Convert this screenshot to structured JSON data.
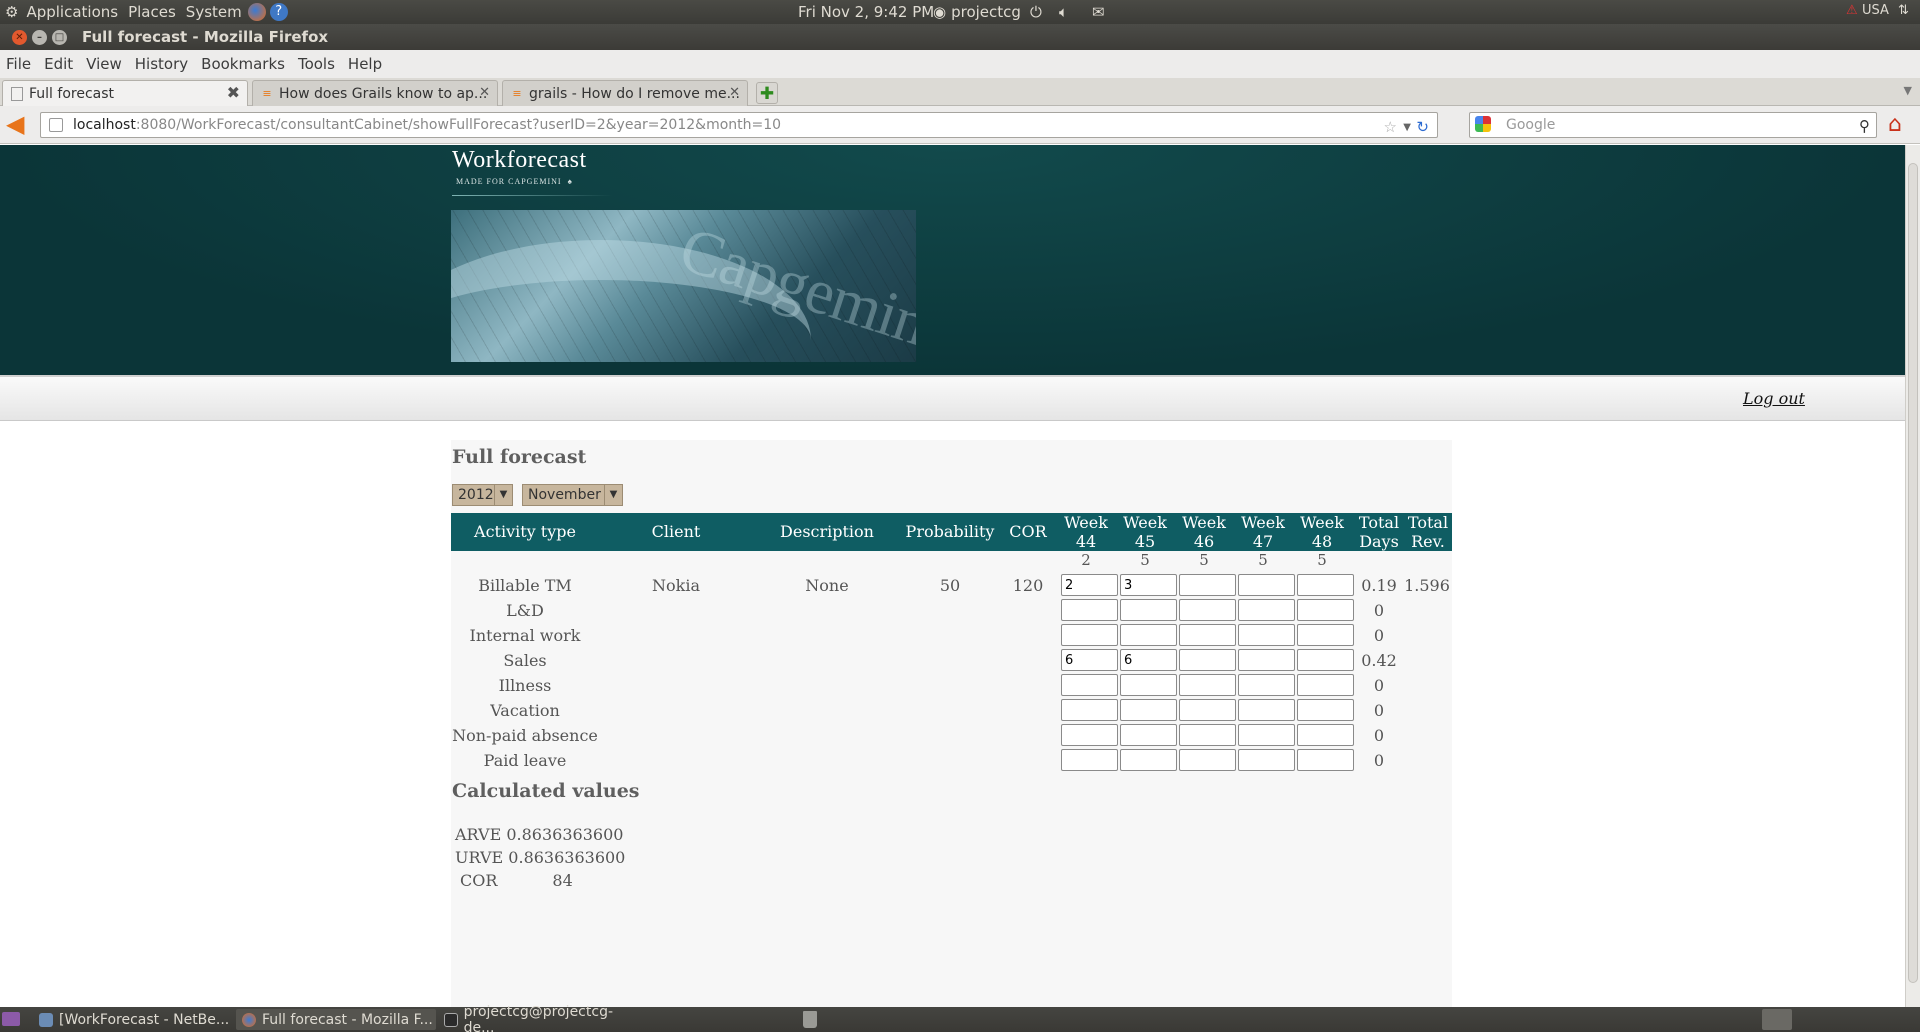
{
  "panel": {
    "menus": [
      "Applications",
      "Places",
      "System"
    ],
    "clock": "Fri Nov  2,  9:42 PM",
    "user": "projectcg",
    "keyboard": "USA"
  },
  "window": {
    "title": "Full forecast - Mozilla Firefox"
  },
  "menubar": [
    "File",
    "Edit",
    "View",
    "History",
    "Bookmarks",
    "Tools",
    "Help"
  ],
  "tabs": [
    {
      "label": "Full forecast"
    },
    {
      "label": "How does Grails know to ap..."
    },
    {
      "label": "grails - How do I remove me..."
    }
  ],
  "url": {
    "host": "localhost",
    "rest": ":8080/WorkForecast/consultantCabinet/showFullForecast?userID=2&year=2012&month=10"
  },
  "search": {
    "placeholder": "Google"
  },
  "site": {
    "logo_name": "Workforecast",
    "logo_tag": "MADE FOR CAPGEMINI",
    "banner_word": "Capgemini",
    "logout": "Log out"
  },
  "forecast": {
    "title": "Full forecast",
    "year": "2012",
    "month": "November",
    "headers": {
      "activity": "Activity type",
      "client": "Client",
      "description": "Description",
      "probability": "Probability",
      "cor": "COR",
      "weeks": [
        {
          "l1": "Week",
          "l2": "44"
        },
        {
          "l1": "Week",
          "l2": "45"
        },
        {
          "l1": "Week",
          "l2": "46"
        },
        {
          "l1": "Week",
          "l2": "47"
        },
        {
          "l1": "Week",
          "l2": "48"
        }
      ],
      "total_days": {
        "l1": "Total",
        "l2": "Days"
      },
      "total_rev": {
        "l1": "Total",
        "l2": "Rev."
      }
    },
    "week_days": [
      "2",
      "5",
      "5",
      "5",
      "5"
    ],
    "rows": [
      {
        "activity": "Billable TM",
        "client": "Nokia",
        "description": "None",
        "probability": "50",
        "cor": "120",
        "weeks": [
          "2",
          "3",
          "",
          "",
          ""
        ],
        "total_days": "0.19",
        "total_rev": "1.596"
      },
      {
        "activity": "L&D",
        "weeks": [
          "",
          "",
          "",
          "",
          ""
        ],
        "total_days": "0"
      },
      {
        "activity": "Internal work",
        "weeks": [
          "",
          "",
          "",
          "",
          ""
        ],
        "total_days": "0"
      },
      {
        "activity": "Sales",
        "weeks": [
          "6",
          "6",
          "",
          "",
          ""
        ],
        "total_days": "0.42"
      },
      {
        "activity": "Illness",
        "weeks": [
          "",
          "",
          "",
          "",
          ""
        ],
        "total_days": "0"
      },
      {
        "activity": "Vacation",
        "weeks": [
          "",
          "",
          "",
          "",
          ""
        ],
        "total_days": "0"
      },
      {
        "activity": "Non-paid absence",
        "weeks": [
          "",
          "",
          "",
          "",
          ""
        ],
        "total_days": "0"
      },
      {
        "activity": "Paid leave",
        "weeks": [
          "",
          "",
          "",
          "",
          ""
        ],
        "total_days": "0"
      }
    ]
  },
  "calculated": {
    "title": "Calculated values",
    "items": [
      {
        "label": "ARVE",
        "value": "0.8636363600"
      },
      {
        "label": "URVE",
        "value": "0.8636363600"
      },
      {
        "label": "COR",
        "value": "84"
      }
    ]
  },
  "taskbar": [
    {
      "label": "[WorkForecast - NetBe..."
    },
    {
      "label": "Full forecast - Mozilla F..."
    },
    {
      "label": "projectcg@projectcg-de..."
    }
  ]
}
